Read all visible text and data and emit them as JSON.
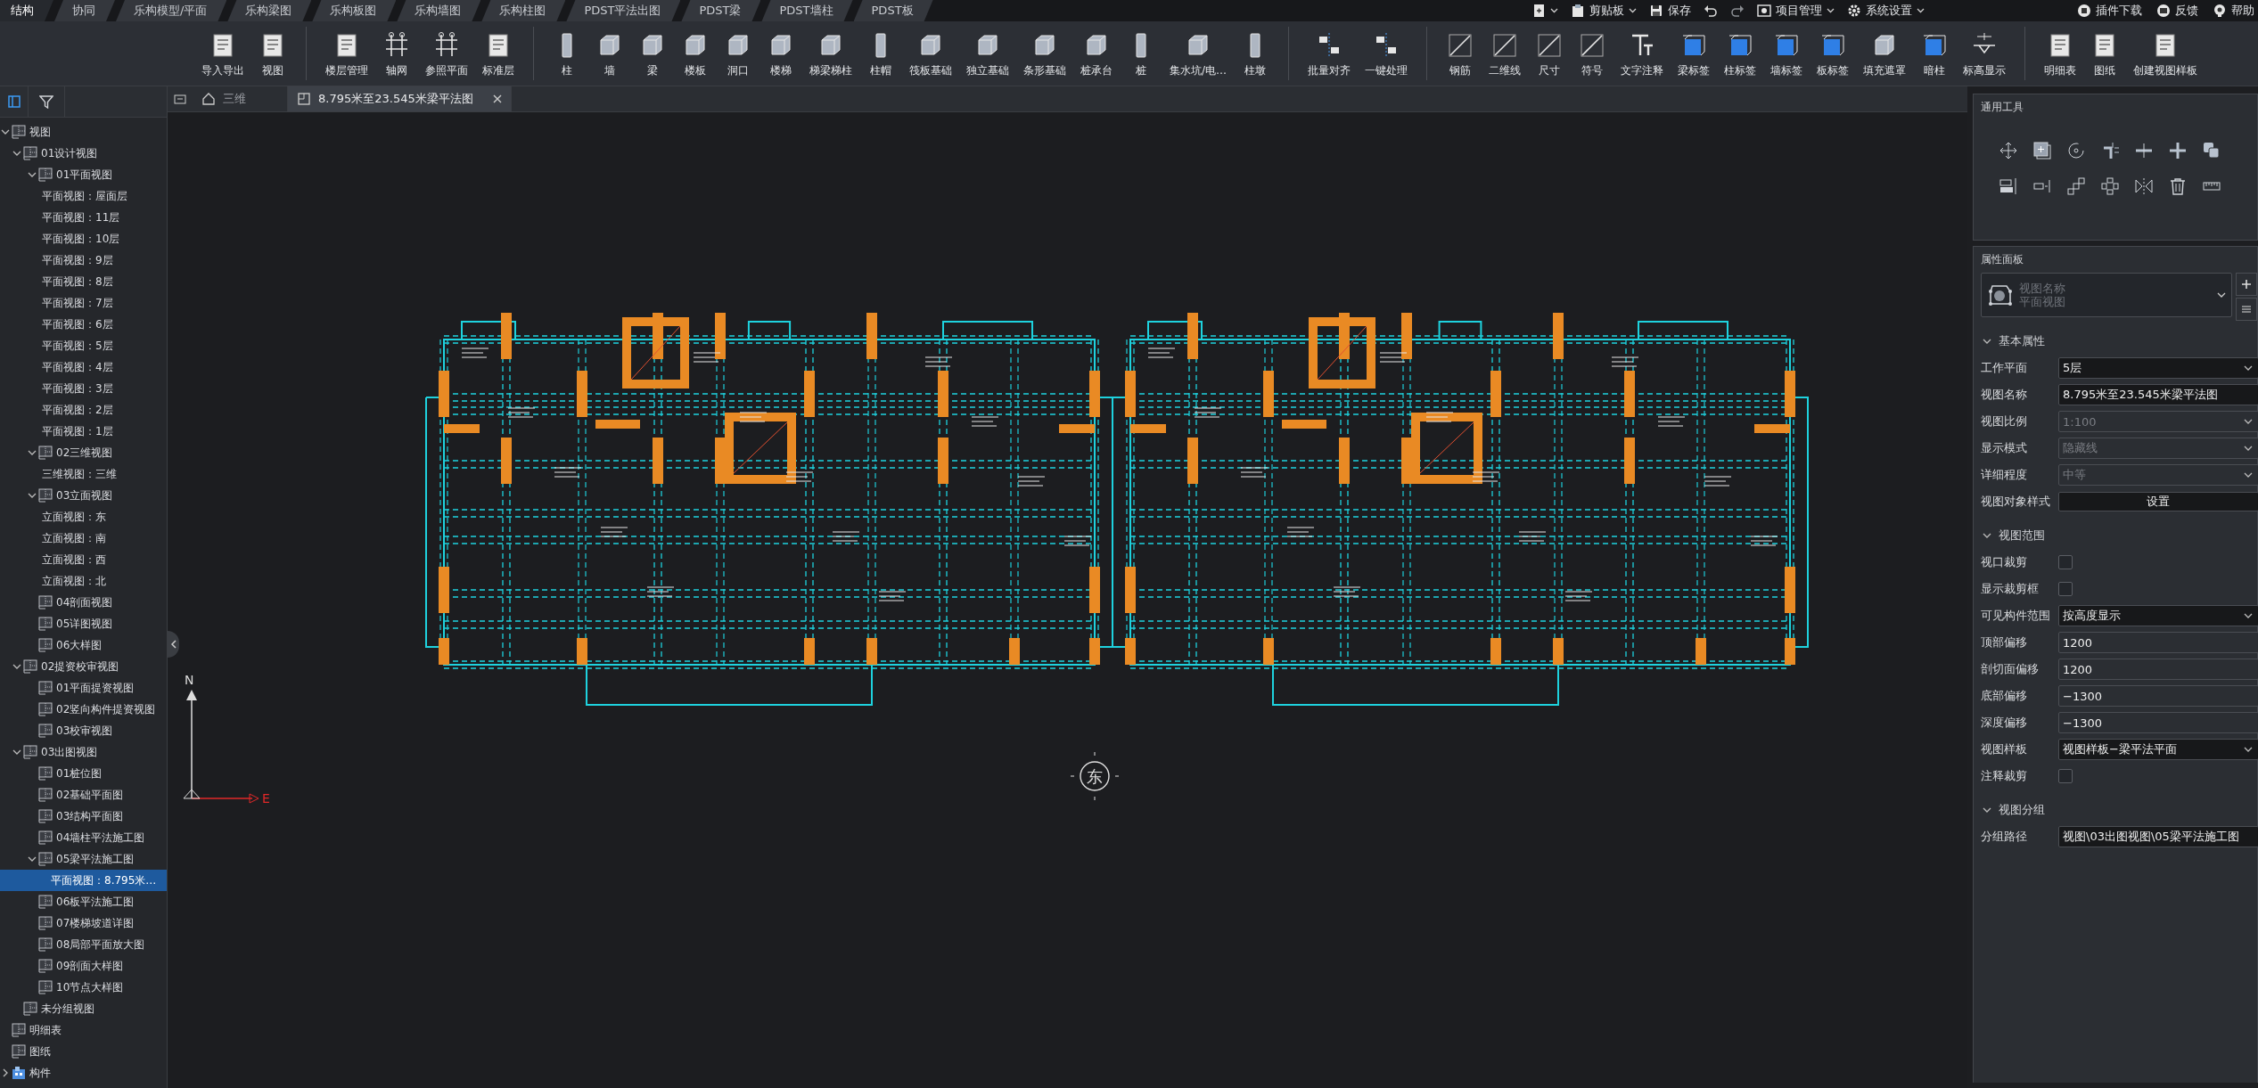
{
  "top_tabs": [
    {
      "label": "结构",
      "selected": true
    },
    {
      "label": "协同",
      "selected": false
    },
    {
      "label": "乐构模型/平面",
      "selected": false
    },
    {
      "label": "乐构梁图",
      "selected": false
    },
    {
      "label": "乐构板图",
      "selected": false
    },
    {
      "label": "乐构墙图",
      "selected": false
    },
    {
      "label": "乐构柱图",
      "selected": false
    },
    {
      "label": "PDST平法出图",
      "selected": false
    },
    {
      "label": "PDST梁",
      "selected": false
    },
    {
      "label": "PDST墙柱",
      "selected": false
    },
    {
      "label": "PDST板",
      "selected": false
    }
  ],
  "quick_actions": [
    {
      "kind": "new"
    },
    {
      "kind": "menu",
      "label": "剪贴板"
    },
    {
      "kind": "save",
      "label": "保存"
    },
    {
      "kind": "undo"
    },
    {
      "kind": "redo"
    },
    {
      "kind": "menu",
      "label": "项目管理"
    },
    {
      "kind": "settings",
      "label": "系统设置"
    }
  ],
  "help_links": [
    {
      "kind": "plugin",
      "label": "插件下载"
    },
    {
      "kind": "feedback",
      "label": "反馈"
    },
    {
      "kind": "help",
      "label": "帮助"
    }
  ],
  "toolbar": {
    "groups": [
      [
        {
          "label": "导入导出"
        },
        {
          "label": "视图"
        }
      ],
      [
        {
          "label": "楼层管理"
        },
        {
          "label": "轴网"
        },
        {
          "label": "参照平面"
        },
        {
          "label": "标准层"
        }
      ],
      [
        {
          "label": "柱"
        },
        {
          "label": "墙"
        },
        {
          "label": "梁"
        },
        {
          "label": "楼板"
        },
        {
          "label": "洞口"
        },
        {
          "label": "楼梯"
        },
        {
          "label": "梯梁梯柱"
        },
        {
          "label": "柱帽"
        },
        {
          "label": "筏板基础"
        },
        {
          "label": "独立基础"
        },
        {
          "label": "条形基础"
        },
        {
          "label": "桩承台"
        },
        {
          "label": "桩"
        },
        {
          "label": "集水坑/电…"
        },
        {
          "label": "柱墩"
        }
      ],
      [
        {
          "label": "批量对齐"
        },
        {
          "label": "一键处理"
        }
      ],
      [
        {
          "label": "钢筋"
        },
        {
          "label": "二维线"
        },
        {
          "label": "尺寸"
        },
        {
          "label": "符号"
        },
        {
          "label": "文字注释"
        },
        {
          "label": "梁标签"
        },
        {
          "label": "柱标签"
        },
        {
          "label": "墙标签"
        },
        {
          "label": "板标签"
        },
        {
          "label": "填充遮罩"
        },
        {
          "label": "暗柱"
        },
        {
          "label": "标高显示"
        }
      ],
      [
        {
          "label": "明细表"
        },
        {
          "label": "图纸"
        },
        {
          "label": "创建视图样板"
        }
      ]
    ]
  },
  "browser": {
    "tree": [
      {
        "label": "视图",
        "kind": "sheet",
        "expanded": true,
        "selected": false,
        "children": [
          {
            "label": "01设计视图",
            "kind": "sheet",
            "expanded": true,
            "selected": false,
            "children": [
              {
                "label": "01平面视图",
                "kind": "sheet",
                "expanded": true,
                "selected": false,
                "children": [
                  {
                    "label": "平面视图：屋面层",
                    "kind": "plain",
                    "selected": false
                  },
                  {
                    "label": "平面视图：11层",
                    "kind": "plain",
                    "selected": false
                  },
                  {
                    "label": "平面视图：10层",
                    "kind": "plain",
                    "selected": false
                  },
                  {
                    "label": "平面视图：9层",
                    "kind": "plain",
                    "selected": false
                  },
                  {
                    "label": "平面视图：8层",
                    "kind": "plain",
                    "selected": false
                  },
                  {
                    "label": "平面视图：7层",
                    "kind": "plain",
                    "selected": false
                  },
                  {
                    "label": "平面视图：6层",
                    "kind": "plain",
                    "selected": false
                  },
                  {
                    "label": "平面视图：5层",
                    "kind": "plain",
                    "selected": false
                  },
                  {
                    "label": "平面视图：4层",
                    "kind": "plain",
                    "selected": false
                  },
                  {
                    "label": "平面视图：3层",
                    "kind": "plain",
                    "selected": false
                  },
                  {
                    "label": "平面视图：2层",
                    "kind": "plain",
                    "selected": false
                  },
                  {
                    "label": "平面视图：1层",
                    "kind": "plain",
                    "selected": false
                  }
                ]
              },
              {
                "label": "02三维视图",
                "kind": "sheet",
                "expanded": true,
                "selected": false,
                "children": [
                  {
                    "label": "三维视图：三维",
                    "kind": "plain",
                    "selected": false
                  }
                ]
              },
              {
                "label": "03立面视图",
                "kind": "sheet",
                "expanded": true,
                "selected": false,
                "children": [
                  {
                    "label": "立面视图：东",
                    "kind": "plain",
                    "selected": false
                  },
                  {
                    "label": "立面视图：南",
                    "kind": "plain",
                    "selected": false
                  },
                  {
                    "label": "立面视图：西",
                    "kind": "plain",
                    "selected": false
                  },
                  {
                    "label": "立面视图：北",
                    "kind": "plain",
                    "selected": false
                  }
                ]
              },
              {
                "label": "04剖面视图",
                "kind": "sheet",
                "selected": false
              },
              {
                "label": "05详图视图",
                "kind": "sheet",
                "selected": false
              },
              {
                "label": "06大样图",
                "kind": "sheet",
                "selected": false
              }
            ]
          },
          {
            "label": "02提资校审视图",
            "kind": "sheet",
            "expanded": true,
            "selected": false,
            "children": [
              {
                "label": "01平面提资视图",
                "kind": "sheet",
                "selected": false
              },
              {
                "label": "02竖向构件提资视图",
                "kind": "sheet",
                "selected": false
              },
              {
                "label": "03校审视图",
                "kind": "sheet",
                "selected": false
              }
            ]
          },
          {
            "label": "03出图视图",
            "kind": "sheet",
            "expanded": true,
            "selected": false,
            "children": [
              {
                "label": "01桩位图",
                "kind": "sheet",
                "selected": false
              },
              {
                "label": "02基础平面图",
                "kind": "sheet",
                "selected": false
              },
              {
                "label": "03结构平面图",
                "kind": "sheet",
                "selected": false
              },
              {
                "label": "04墙柱平法施工图",
                "kind": "sheet",
                "selected": false
              },
              {
                "label": "05梁平法施工图",
                "kind": "sheet",
                "expanded": true,
                "selected": false,
                "children": [
                  {
                    "label": "平面视图：8.795米…",
                    "kind": "plain",
                    "selected": true
                  }
                ]
              },
              {
                "label": "06板平法施工图",
                "kind": "sheet",
                "selected": false
              },
              {
                "label": "07楼梯坡道详图",
                "kind": "sheet",
                "selected": false
              },
              {
                "label": "08局部平面放大图",
                "kind": "sheet",
                "selected": false
              },
              {
                "label": "09剖面大样图",
                "kind": "sheet",
                "selected": false
              },
              {
                "label": "10节点大样图",
                "kind": "sheet",
                "selected": false
              }
            ]
          },
          {
            "label": "未分组视图",
            "kind": "sheet",
            "selected": false
          }
        ]
      },
      {
        "label": "明细表",
        "kind": "sheet",
        "selected": false
      },
      {
        "label": "图纸",
        "kind": "sheet",
        "selected": false
      },
      {
        "label": "构件",
        "kind": "component",
        "expanded": false,
        "selected": false
      }
    ]
  },
  "doc_tabs": [
    {
      "label": "三维",
      "kind": "model",
      "selected": false,
      "closable": false
    },
    {
      "label": "8.795米至23.545米梁平法图",
      "kind": "plan",
      "selected": true,
      "closable": true
    }
  ],
  "canvas": {
    "axis_north": "N",
    "axis_east": "E",
    "view_marker": "东"
  },
  "tools_panel": {
    "title": "通用工具"
  },
  "properties": {
    "title": "属性面板",
    "type_name": "视图名称",
    "type_value": "平面视图",
    "sections": [
      {
        "title": "基本属性",
        "expanded": true,
        "rows": [
          {
            "label": "工作平面",
            "kind": "select",
            "value": "5层",
            "disabled": false
          },
          {
            "label": "视图名称",
            "kind": "input",
            "value": "8.795米至23.545米梁平法图",
            "disabled": false
          },
          {
            "label": "视图比例",
            "kind": "select",
            "value": "1:100",
            "disabled": true
          },
          {
            "label": "显示模式",
            "kind": "select",
            "value": "隐藏线",
            "disabled": true
          },
          {
            "label": "详细程度",
            "kind": "select",
            "value": "中等",
            "disabled": true
          },
          {
            "label": "视图对象样式",
            "kind": "button",
            "value": "设置"
          }
        ]
      },
      {
        "title": "视图范围",
        "expanded": true,
        "rows": [
          {
            "label": "视口裁剪",
            "kind": "checkbox",
            "checked": false
          },
          {
            "label": "显示裁剪框",
            "kind": "checkbox",
            "checked": false
          },
          {
            "label": "可见构件范围",
            "kind": "select",
            "value": "按高度显示",
            "disabled": false
          },
          {
            "label": "顶部偏移",
            "kind": "number",
            "value": "1200"
          },
          {
            "label": "剖切面偏移",
            "kind": "number",
            "value": "1200"
          },
          {
            "label": "底部偏移",
            "kind": "number",
            "value": "−1300"
          },
          {
            "label": "深度偏移",
            "kind": "number",
            "value": "−1300"
          },
          {
            "label": "视图样板",
            "kind": "select",
            "value": "视图样板−梁平法平面",
            "disabled": false
          },
          {
            "label": "注释裁剪",
            "kind": "checkbox",
            "checked": false
          }
        ]
      },
      {
        "title": "视图分组",
        "expanded": true,
        "rows": [
          {
            "label": "分组路径",
            "kind": "input",
            "value": "视图\\03出图视图\\05梁平法施工图",
            "disabled": false
          }
        ]
      }
    ]
  }
}
